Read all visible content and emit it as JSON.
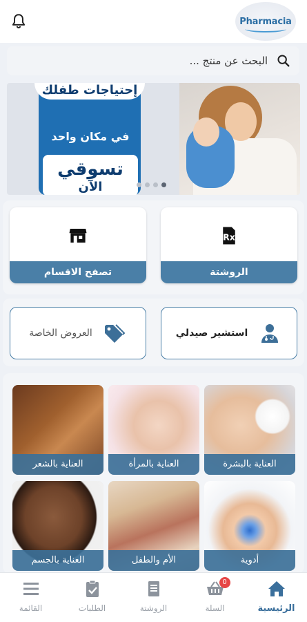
{
  "header": {
    "logo_text": "Pharmacia",
    "icons": {
      "notifications": "bell-icon"
    }
  },
  "search": {
    "placeholder": "البحث عن منتج ...",
    "icon": "search-icon"
  },
  "banner": {
    "line1": "إحتياجات طفلك",
    "line2": "في مكان واحد",
    "line3": "تسوقي",
    "line4": "الآن",
    "slides_count": 4,
    "active_slide": 4
  },
  "quick_tiles": [
    {
      "label": "تصفح الاقسام",
      "icon": "store-icon"
    },
    {
      "label": "الروشتة",
      "icon": "prescription-icon"
    }
  ],
  "actions": [
    {
      "label": "العروض الخاصة",
      "icon": "tag-icon"
    },
    {
      "label": "استشير صيدلي",
      "icon": "pharmacist-icon"
    }
  ],
  "categories": [
    {
      "label": "العناية بالشعر",
      "image": "hair-care-photo"
    },
    {
      "label": "العناية بالمرأة",
      "image": "women-care-photo"
    },
    {
      "label": "العناية بالبشرة",
      "image": "skin-care-photo"
    },
    {
      "label": "العناية بالجسم",
      "image": "body-care-photo"
    },
    {
      "label": "الأم والطفل",
      "image": "mother-child-photo"
    },
    {
      "label": "أدوية",
      "image": "medicine-photo"
    }
  ],
  "bottom_nav": [
    {
      "label": "القائمة",
      "icon": "menu-icon",
      "active": false
    },
    {
      "label": "الطلبات",
      "icon": "orders-icon",
      "active": false
    },
    {
      "label": "الروشتة",
      "icon": "prescription-list-icon",
      "active": false
    },
    {
      "label": "السلة",
      "icon": "cart-icon",
      "active": false,
      "badge": "0"
    },
    {
      "label": "الرئيسية",
      "icon": "home-icon",
      "active": true
    }
  ],
  "colors": {
    "primary": "#4a7fa7",
    "active_nav": "#3a6f9c",
    "badge": "#e64545",
    "background": "#eef1f6"
  }
}
